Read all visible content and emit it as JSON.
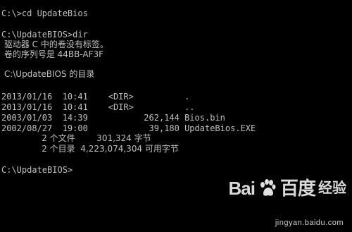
{
  "console": {
    "lines": {
      "cmd1": "C:\\>cd UpdateBios",
      "cmd2": "C:\\UpdateBIOS>dir",
      "volume_label": " 驱动器 C 中的卷没有标签。",
      "serial": " 卷的序列号是 44BB-AF3F",
      "dir_of": " C:\\UpdateBIOS 的目录",
      "entry1": "2013/01/16  10:41    <DIR>          .",
      "entry2": "2013/01/16  10:41    <DIR>          ..",
      "entry3": "2003/01/03  14:39           262,144 Bios.bin",
      "entry4": "2002/08/27  19:00            39,180 UpdateBios.EXE",
      "files_summary": "               2 个文件        301,324 字节",
      "dirs_summary": "               2 个目录  4,223,074,304 可用字节",
      "prompt": "C:\\UpdateBIOS>"
    }
  },
  "watermark": {
    "logo_left": "Bai",
    "logo_right": "百度",
    "logo_suffix": "经验",
    "url": "jingyan.baidu.com",
    "icon": "paw-icon"
  }
}
